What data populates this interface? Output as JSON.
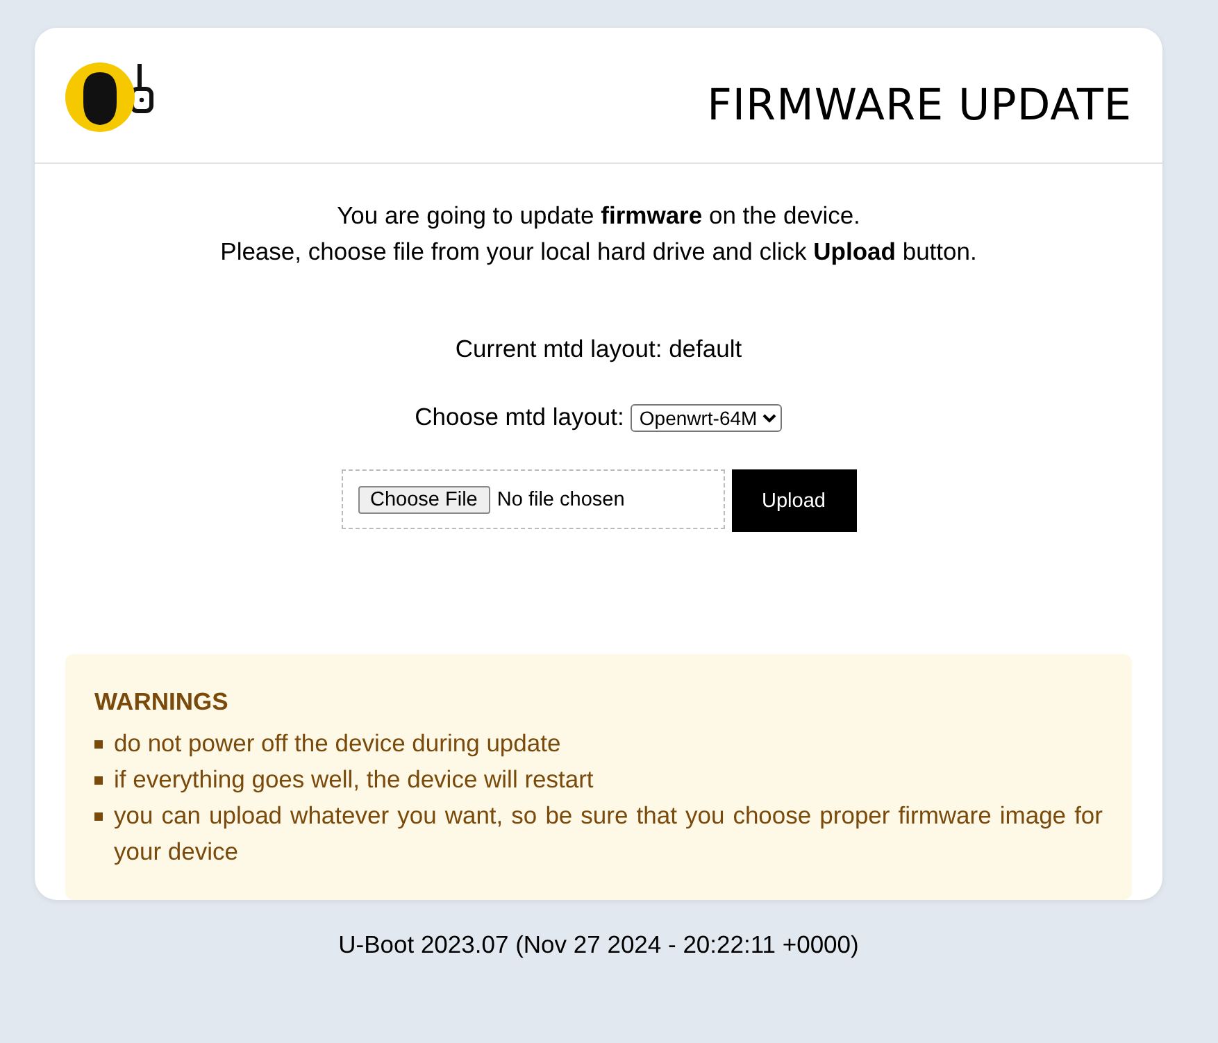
{
  "header": {
    "title": "FIRMWARE UPDATE"
  },
  "intro": [
    "You are going to update **firmware** on the device.",
    "Please, choose file from your local hard drive and click **Upload** button."
  ],
  "current_layout": "Current mtd layout: default",
  "layout_select": {
    "label": "Choose mtd layout:",
    "value": "Openwrt-64M"
  },
  "file_picker": {
    "button": "Choose File",
    "status": "No file chosen"
  },
  "upload_button": "Upload",
  "warnings": {
    "title": "WARNINGS",
    "items": [
      "do not power off the device during update",
      "if everything goes well, the device will restart",
      "you can upload whatever you want, so be sure that you choose proper firmware image for your device"
    ]
  },
  "footer": "U-Boot 2023.07 (Nov 27 2024 - 20:22:11 +0000)"
}
